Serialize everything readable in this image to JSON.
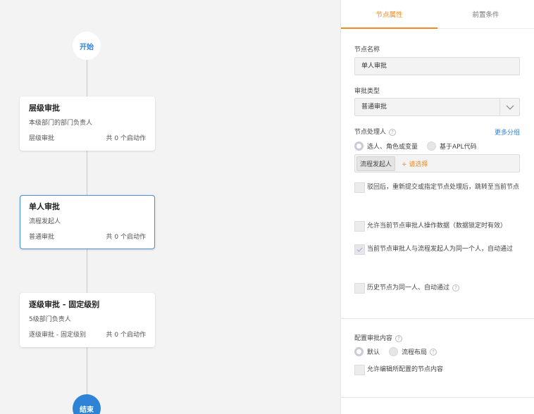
{
  "flow": {
    "start_label": "开始",
    "end_label": "结束",
    "nodes": [
      {
        "title": "层级审批",
        "desc": "本级部门的部门负责人",
        "type": "层级审批",
        "actions": "共 0 个启动作"
      },
      {
        "title": "单人审批",
        "desc": "流程发起人",
        "type": "普通审批",
        "actions": "共 0 个启动作"
      },
      {
        "title": "逐级审批 - 固定级别",
        "desc": "5级部门负责人",
        "type": "逐级审批 - 固定级别",
        "actions": "共 0 个启动作"
      }
    ]
  },
  "panel": {
    "tabs": [
      {
        "label": "节点属性",
        "active": true
      },
      {
        "label": "前置条件",
        "active": false
      }
    ],
    "node_name_label": "节点名称",
    "node_name_value": "单人审批",
    "approval_type_label": "审批类型",
    "approval_type_value": "普通审批",
    "handler_label": "节点处理人",
    "more_groups": "更多分组",
    "handler_options": [
      {
        "label": "选人、角色或变量",
        "selected": true
      },
      {
        "label": "基于APL代码",
        "selected": false
      }
    ],
    "handler_tag": "流程发起人",
    "handler_add": "+ 请选择",
    "checks": [
      {
        "label": "驳回后，重新提交或指定节点处理后，跳转至当前节点",
        "checked": false
      },
      {
        "label": "允许当前节点审批人操作数据（数据锁定时有效）",
        "checked": false
      },
      {
        "label": "当前节点审批人与流程发起人为同一个人，自动通过",
        "checked": true
      },
      {
        "label": "历史节点为同一人、自动通过",
        "checked": false
      }
    ],
    "content_label": "配置审批内容",
    "content_options": [
      {
        "label": "默认",
        "selected": true
      },
      {
        "label": "流程布局",
        "selected": false
      }
    ],
    "content_check": "允许编辑所配置的节点内容"
  },
  "colors": {
    "accent_orange": "#f08a24",
    "accent_blue": "#2f83d6"
  }
}
